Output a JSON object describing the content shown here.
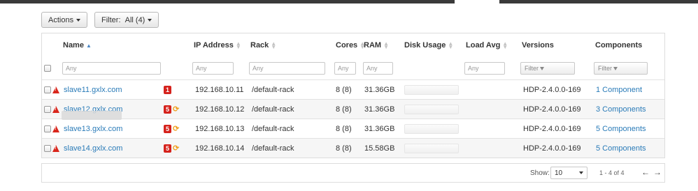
{
  "toolbar": {
    "actions_label": "Actions",
    "filter_label": "Filter:",
    "filter_value": "All (4)"
  },
  "columns": {
    "name": "Name",
    "ip": "IP Address",
    "rack": "Rack",
    "cores": "Cores",
    "ram": "RAM",
    "disk": "Disk Usage",
    "load": "Load Avg",
    "versions": "Versions",
    "components": "Components"
  },
  "filters": {
    "name_placeholder": "Any",
    "ip_placeholder": "Any",
    "rack_placeholder": "Any",
    "cores_placeholder": "Any",
    "ram_placeholder": "Any",
    "load_placeholder": "Any",
    "versions_label": "Filter",
    "components_label": "Filter"
  },
  "hosts": [
    {
      "name": "slave11.gxlx.com",
      "alerts": "1",
      "ip": "192.168.10.11",
      "rack": "/default-rack",
      "cores": "8 (8)",
      "ram": "31.36GB",
      "version": "HDP-2.4.0.0-169",
      "components": "1 Component"
    },
    {
      "name": "slave12.gxlx.com",
      "alerts": "5",
      "ip": "192.168.10.12",
      "rack": "/default-rack",
      "cores": "8 (8)",
      "ram": "31.36GB",
      "version": "HDP-2.4.0.0-169",
      "components": "3 Components"
    },
    {
      "name": "slave13.gxlx.com",
      "alerts": "5",
      "ip": "192.168.10.13",
      "rack": "/default-rack",
      "cores": "8 (8)",
      "ram": "31.36GB",
      "version": "HDP-2.4.0.0-169",
      "components": "5 Components"
    },
    {
      "name": "slave14.gxlx.com",
      "alerts": "5",
      "ip": "192.168.10.14",
      "rack": "/default-rack",
      "cores": "8 (8)",
      "ram": "15.58GB",
      "version": "HDP-2.4.0.0-169",
      "components": "5 Components"
    }
  ],
  "footer": {
    "show_label": "Show:",
    "page_size": "10",
    "range": "1 - 4 of 4"
  },
  "icons": {
    "alert": "warning-triangle-icon",
    "restart": "refresh-icon",
    "prev": "arrow-left-icon",
    "next": "arrow-right-icon"
  },
  "colors": {
    "link": "#2a7bb8",
    "alert_badge": "#d5221c",
    "restart": "#f0a020"
  }
}
